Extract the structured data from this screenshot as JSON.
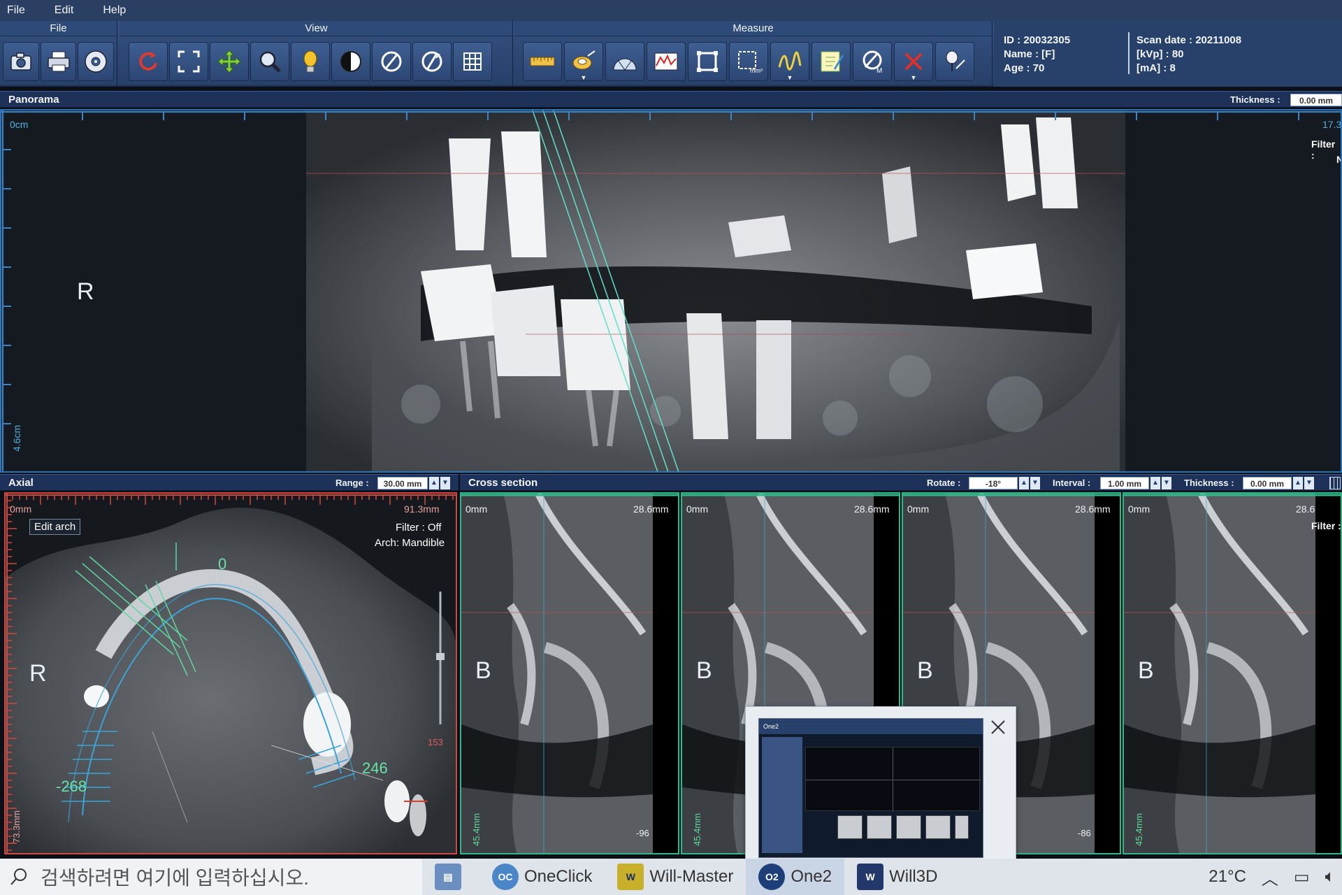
{
  "menu": [
    "File",
    "Edit",
    "Help"
  ],
  "ribbon": {
    "groups": [
      {
        "label": "File",
        "tools": [
          "camera-icon",
          "printer-icon",
          "disc-icon"
        ]
      },
      {
        "label": "View",
        "tools": [
          "rotate-icon",
          "fit-screen-icon",
          "move-icon",
          "zoom-icon",
          "brightness-icon",
          "contrast-icon",
          "rotate-view-icon",
          "reset-view-icon",
          "grid-icon"
        ]
      },
      {
        "label": "Measure",
        "tools": [
          "ruler-icon",
          "tape-measure-icon",
          "angle-icon",
          "profile-chart-icon",
          "area-rect-icon",
          "area-mm2-icon",
          "freehand-icon",
          "note-icon",
          "implant-icon",
          "delete-icon",
          "pin-icon"
        ]
      }
    ]
  },
  "patient": {
    "id": "ID : 20032305",
    "name": "Name : [F]",
    "age": "Age : 70",
    "scan_date": "Scan date : 20211008",
    "kvp": "[kVp] : 80",
    "ma": "[mA] : 8"
  },
  "panorama": {
    "title": "Panorama",
    "thickness_label": "Thickness :",
    "thickness_value": "0.00 mm",
    "start_cm": "0cm",
    "end_cm": "17.3",
    "side_cm": "4.6cm",
    "side_letter": "R",
    "filter_label": "Filter :",
    "filter_value_cut": "N"
  },
  "axial": {
    "title": "Axial",
    "range_label": "Range :",
    "range_value": "30.00 mm",
    "start": "0mm",
    "end": "91.3mm",
    "side_mm": "73.3mm",
    "edit_arch": "Edit arch",
    "filter": "Filter : Off",
    "arch": "Arch: Mandible",
    "side_letter": "R",
    "arch_zero": "0",
    "arch_left": "-268",
    "arch_right": "246",
    "slider_value": "153"
  },
  "cross": {
    "title": "Cross section",
    "rotate_label": "Rotate :",
    "rotate_value": "-18°",
    "interval_label": "Interval :",
    "interval_value": "1.00 mm",
    "thickness_label": "Thickness :",
    "thickness_value": "0.00 mm",
    "filter_label": "Filter :",
    "slices": [
      {
        "start": "0mm",
        "end": "28.6mm",
        "side": "45.4mm",
        "index": "-96",
        "letter": "B"
      },
      {
        "start": "0mm",
        "end": "28.6mm",
        "side": "45.4mm",
        "index": "",
        "letter": "B"
      },
      {
        "start": "0mm",
        "end": "28.6mm",
        "side": "",
        "index": "-86",
        "letter": "B"
      },
      {
        "start": "0mm",
        "end": "28.6",
        "side": "45.4mm",
        "index": "",
        "letter": "B"
      }
    ]
  },
  "popup": {
    "app_name": "One2"
  },
  "taskbar": {
    "search_placeholder": "검색하려면 여기에 입력하십시오.",
    "apps": [
      {
        "label": "",
        "icon": "folder-app-icon"
      },
      {
        "label": "OneClick",
        "icon": "oneclick-icon"
      },
      {
        "label": "Will-Master",
        "icon": "will-master-icon"
      },
      {
        "label": "One2",
        "icon": "one2-icon"
      },
      {
        "label": "Will3D",
        "icon": "will3d-icon"
      }
    ],
    "temperature": "21°C"
  }
}
